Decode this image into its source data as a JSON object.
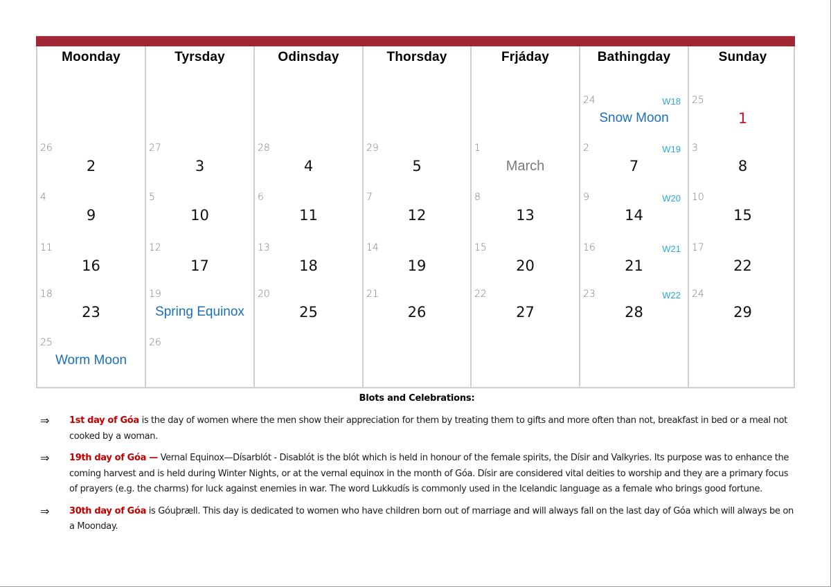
{
  "calendar": {
    "header_color": "#a12735",
    "days": [
      "Moonday",
      "Tyrsday",
      "Odinsday",
      "Thorsday",
      "Frjáday",
      "Bathingday",
      "Sunday"
    ],
    "rows": [
      [
        {},
        {},
        {},
        {},
        {},
        {
          "small": "24",
          "week": "W18",
          "event": "Snow Moon"
        },
        {
          "small": "25",
          "big": "1",
          "big_color": "red"
        }
      ],
      [
        {
          "small": "26",
          "big": "2"
        },
        {
          "small": "27",
          "big": "3"
        },
        {
          "small": "28",
          "big": "4"
        },
        {
          "small": "29",
          "big": "5"
        },
        {
          "small": "1",
          "month": "March"
        },
        {
          "small": "2",
          "week": "W19",
          "big": "7"
        },
        {
          "small": "3",
          "big": "8"
        }
      ],
      [
        {
          "small": "4",
          "big": "9"
        },
        {
          "small": "5",
          "big": "10"
        },
        {
          "small": "6",
          "big": "11"
        },
        {
          "small": "7",
          "big": "12"
        },
        {
          "small": "8",
          "big": "13"
        },
        {
          "small": "9",
          "week": "W20",
          "big": "14"
        },
        {
          "small": "10",
          "big": "15"
        }
      ],
      [
        {
          "small": "11",
          "big": "16"
        },
        {
          "small": "12",
          "big": "17"
        },
        {
          "small": "13",
          "big": "18"
        },
        {
          "small": "14",
          "big": "19"
        },
        {
          "small": "15",
          "big": "20"
        },
        {
          "small": "16",
          "week": "W21",
          "big": "21"
        },
        {
          "small": "17",
          "big": "22"
        }
      ],
      [
        {
          "small": "18",
          "big": "23"
        },
        {
          "small": "19",
          "event": "Spring Equinox"
        },
        {
          "small": "20",
          "big": "25"
        },
        {
          "small": "21",
          "big": "26"
        },
        {
          "small": "22",
          "big": "27"
        },
        {
          "small": "23",
          "week": "W22",
          "big": "28"
        },
        {
          "small": "24",
          "big": "29"
        }
      ],
      [
        {
          "small": "25",
          "event": "Worm Moon"
        },
        {
          "small": "26"
        },
        {},
        {},
        {},
        {},
        {}
      ]
    ]
  },
  "notes": {
    "title": "Blots and Celebrations:",
    "arrow_glyph": "⇒",
    "items": [
      {
        "highlight": "1st day of Góa",
        "text": " is the day of women where the men  show their appreciation for them by treating them to gifts and more often than not, breakfast in bed or a meal not cooked by a woman."
      },
      {
        "highlight": "19th day of Góa —",
        "text": " Vernal Equinox—Dísarblót -  Disablót is the blót which is held in honour of the female spirits, the Dísir and Valkyries. Its purpose was to enhance the coming harvest and is held during Winter Nights, or at the vernal equinox in the month of Góa. Dísir are considered vital deities to worship and they are a primary focus of prayers (e.g. the charms) for luck against enemies in war. The word Lukkudís is commonly used in the Icelandic language as a female who brings good fortune."
      },
      {
        "highlight": "30th day of Góa",
        "text": " is Góuþræll. This day is dedicated to women who have children born out of marriage and will always fall on the last day of Góa which will always be on a Moonday."
      }
    ]
  }
}
